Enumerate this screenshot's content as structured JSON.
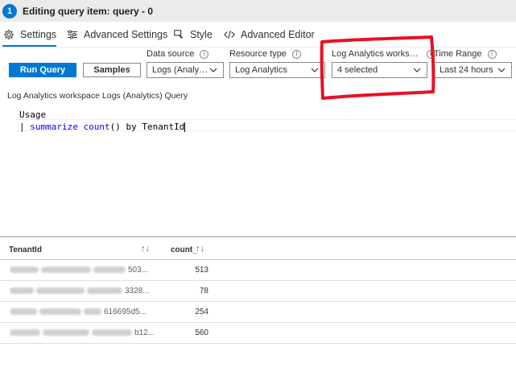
{
  "title_bar": {
    "step_number": "1",
    "title": "Editing query item: query - 0"
  },
  "tabs": [
    {
      "label": "Settings",
      "icon": "gear-icon",
      "active": true
    },
    {
      "label": "Advanced Settings",
      "icon": "sliders-icon",
      "active": false
    },
    {
      "label": "Style",
      "icon": "brush-icon",
      "active": false
    },
    {
      "label": "Advanced Editor",
      "icon": "code-icon",
      "active": false
    }
  ],
  "toolbar": {
    "run_query_label": "Run Query",
    "samples_label": "Samples"
  },
  "fields": {
    "data_source": {
      "label": "Data source",
      "value": "Logs (Analy…"
    },
    "resource_type": {
      "label": "Resource type",
      "value": "Log Analytics"
    },
    "workspaces": {
      "label": "Log Analytics works…",
      "value": "4 selected"
    },
    "time_range": {
      "label": "Time Range",
      "value": "Last 24 hours"
    }
  },
  "query": {
    "label": "Log Analytics workspace Logs (Analytics) Query",
    "line1": "Usage",
    "line2_pipe": "| ",
    "line2_keyword": "summarize",
    "line2_fn": "count",
    "line2_rest": "() by TenantId"
  },
  "results": {
    "columns": [
      "TenantId",
      "count_"
    ],
    "sort_glyph": "↑↓",
    "rows": [
      {
        "tenant_suffix": "503...",
        "count": "513"
      },
      {
        "tenant_suffix": "3328...",
        "count": "78"
      },
      {
        "tenant_suffix": "616695d5...",
        "count": "254"
      },
      {
        "tenant_suffix": "b12...",
        "count": "560"
      }
    ]
  },
  "colors": {
    "accent": "#0078d4",
    "annotation": "#e81123"
  }
}
